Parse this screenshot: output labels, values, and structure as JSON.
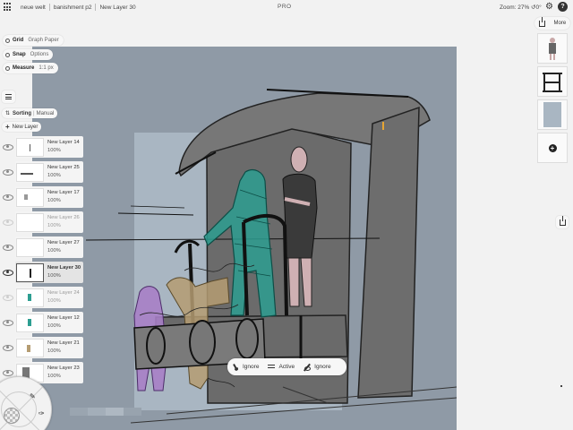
{
  "topbar": {
    "breadcrumbs": [
      "neue welt",
      "banishment p2",
      "New Layer 30"
    ],
    "center_label": "PRO",
    "zoom": "Zoom: 27% ↺0°"
  },
  "controls": {
    "grid": {
      "label": "Grid",
      "value": "Graph Paper"
    },
    "snap": {
      "label": "Snap",
      "value": "Options"
    },
    "measure": {
      "label": "Measure",
      "value": "1:1 px"
    }
  },
  "layers_panel": {
    "sorting_label": "Sorting",
    "sorting_value": "Manual",
    "new_layer": "New Layer",
    "layers": [
      {
        "name": "New Layer 14",
        "opacity": "100%",
        "visible": true
      },
      {
        "name": "New Layer 25",
        "opacity": "100%",
        "visible": true
      },
      {
        "name": "New Layer 17",
        "opacity": "100%",
        "visible": true
      },
      {
        "name": "New Layer 26",
        "opacity": "100%",
        "visible": false
      },
      {
        "name": "New Layer 27",
        "opacity": "100%",
        "visible": true
      },
      {
        "name": "New Layer 30",
        "opacity": "100%",
        "visible": true,
        "selected": true
      },
      {
        "name": "New Layer 24",
        "opacity": "100%",
        "visible": false
      },
      {
        "name": "New Layer 12",
        "opacity": "100%",
        "visible": true
      },
      {
        "name": "New Layer 21",
        "opacity": "100%",
        "visible": true
      },
      {
        "name": "New Layer 23",
        "opacity": "100%",
        "visible": true
      }
    ]
  },
  "right_panel": {
    "more_label": "More"
  },
  "bottom_toolbar": {
    "items": [
      {
        "icon": "brush-icon",
        "label": "Ignore"
      },
      {
        "icon": "lines-icon",
        "label": "Active"
      },
      {
        "icon": "eraser-icon",
        "label": "Ignore"
      }
    ]
  },
  "colors": {
    "canvas_bg": "#8f9aa6",
    "paper": "#a9b6c2",
    "teal": "#2d9e91",
    "purple": "#a77fc6",
    "tan": "#b59c72",
    "dress": "#3a3a3a",
    "ui_bg": "#f2f2f2"
  }
}
